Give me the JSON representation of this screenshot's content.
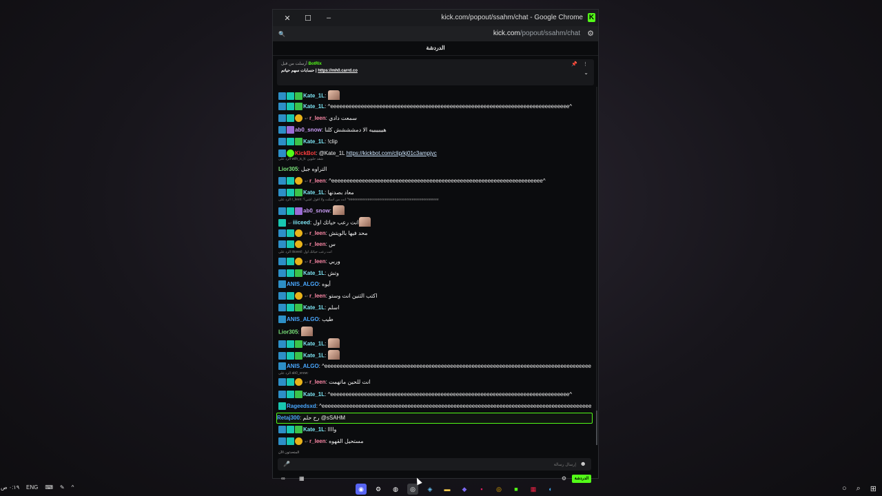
{
  "window": {
    "title": "kick.com/popout/ssahm/chat - Google Chrome",
    "close": "✕",
    "maximize": "☐",
    "minimize": "–",
    "logo": "K"
  },
  "urlbar": {
    "host": "kick.com",
    "path": "/popout/ssahm/chat",
    "search_icon": "🔍",
    "tune_icon": "⚙"
  },
  "chat": {
    "header": "الدردشة",
    "pinned": {
      "meta": "أرسلت من قبل",
      "bot_name": "BotRix",
      "text": "حسابات سهم حياتم |",
      "link": "https://mh0.carrd.co"
    },
    "typing_text": "المتحدثون الآن",
    "input_placeholder": "إرسال رسالة",
    "send_label": "الدردشة"
  },
  "messages": [
    {
      "user": "Kate_1L",
      "color": "#7ee5f5",
      "badges": [
        "blue",
        "teal",
        "green"
      ],
      "text": "",
      "emote": true
    },
    {
      "user": "Kate_1L",
      "color": "#7ee5f5",
      "badges": [
        "blue",
        "teal",
        "green"
      ],
      "text": "^eeeeeeeeeeeeeeeeeeeeeeeeeeeeeeeeeeeeeeeeeeeeeeeeeeeeeeeeeeeeeeeeeeeeeeeeeeeeee^"
    },
    {
      "user": "r_leen",
      "color": "#ff8aa8",
      "badges": [
        "blue",
        "teal",
        "gold"
      ],
      "text": "سمعت دادي",
      "arrow": true
    },
    {
      "user": "ab0_snow",
      "color": "#c79bf2",
      "badges": [
        "blue",
        "purple"
      ],
      "text": "هيييييييه الا دمشششش كلنا"
    },
    {
      "user": "Kate_1L",
      "color": "#7ee5f5",
      "badges": [
        "blue",
        "teal",
        "green"
      ],
      "text": "!clip"
    },
    {
      "user": "KickBot",
      "color": "#ff3e3e",
      "badges": [
        "blue",
        "star"
      ],
      "text": "@Kate_1L",
      "link": "https://kickbot.com/clip/kj01c3ampjyc"
    },
    {
      "user": "Lior305",
      "color": "#7ce67c",
      "badges": [],
      "text": "التراوه جبل"
    },
    {
      "user": "r_leen",
      "color": "#ff8aa8",
      "badges": [
        "blue",
        "teal",
        "gold"
      ],
      "text": "^eeeeeeeeeeeeeeeeeeeeeeeeeeeeeeeeeeeeeeeeeeeeeeeeeeeeeeeeeeeeeeeeeeeee^",
      "arrow": true
    },
    {
      "user": "Kate_1L",
      "color": "#7ee5f5",
      "badges": [
        "blue",
        "teal",
        "green"
      ],
      "text": "معاد بصدنها"
    },
    {
      "user": "ab0_snow",
      "color": "#c79bf2",
      "badges": [
        "blue",
        "teal",
        "purple"
      ],
      "text": "",
      "emote": true
    },
    {
      "user": "iiiceed",
      "color": "#7ee5f5",
      "badges": [
        "teal"
      ],
      "text": "انت رعب حياتك اول",
      "emote": true,
      "arrow": true
    },
    {
      "user": "r_leen",
      "color": "#ff8aa8",
      "badges": [
        "blue",
        "teal",
        "gold"
      ],
      "text": "محد فيها بالويتش",
      "arrow": true
    },
    {
      "user": "r_leen",
      "color": "#ff8aa8",
      "badges": [
        "blue",
        "teal",
        "gold"
      ],
      "text": "س",
      "arrow": true
    },
    {
      "user": "r_leen",
      "color": "#ff8aa8",
      "badges": [
        "blue",
        "teal",
        "gold"
      ],
      "text": "وربي",
      "arrow": true
    },
    {
      "user": "Kate_1L",
      "color": "#7ee5f5",
      "badges": [
        "blue",
        "teal",
        "green"
      ],
      "text": "وتش"
    },
    {
      "user": "ANIS_ALGO",
      "color": "#4aa8ff",
      "badges": [
        "blue"
      ],
      "text": "أيوه"
    },
    {
      "user": "r_leen",
      "color": "#ff8aa8",
      "badges": [
        "blue",
        "teal",
        "gold"
      ],
      "text": "اكتب الثنين انت وستو",
      "arrow": true
    },
    {
      "user": "Kate_1L",
      "color": "#7ee5f5",
      "badges": [
        "blue",
        "teal",
        "green"
      ],
      "text": "اسلم"
    },
    {
      "user": "ANIS_ALGO",
      "color": "#4aa8ff",
      "badges": [
        "blue"
      ],
      "text": "طيب"
    },
    {
      "user": "Lior305",
      "color": "#7ce67c",
      "badges": [],
      "text": "",
      "emote": true
    },
    {
      "user": "Kate_1L",
      "color": "#7ee5f5",
      "badges": [
        "blue",
        "teal",
        "green"
      ],
      "text": "",
      "emote": true
    },
    {
      "user": "Kate_1L",
      "color": "#7ee5f5",
      "badges": [
        "blue",
        "teal",
        "green"
      ],
      "text": "",
      "emote": true
    },
    {
      "user": "ANIS_ALGO",
      "color": "#4aa8ff",
      "badges": [
        "blue"
      ],
      "text": "^eeeeeeeeeeeeeeeeeeeeeeeeeeeeeeeeeeeeeeeeeeeeeeeeeeeeeeeeeeeeeeeeeeeeeeeeeeeeeeeeeeeeeeeee^"
    },
    {
      "user": "r_leen",
      "color": "#ff8aa8",
      "badges": [
        "blue",
        "teal",
        "gold"
      ],
      "text": "انت للحين ماتهمت",
      "arrow": true
    },
    {
      "user": "Kate_1L",
      "color": "#7ee5f5",
      "badges": [
        "blue",
        "teal",
        "green"
      ],
      "text": "^eeeeeeeeeeeeeeeeeeeeeeeeeeeeeeeeeeeeeeeeeeeeeeeeeeeeeeeeeeeeeeeeeeeeeeeeeeeeee^"
    },
    {
      "user": "Rageedsxd",
      "color": "#4aa8ff",
      "badges": [
        "teal"
      ],
      "text": "^eeeeeeeeeeeeeeeeeeeeeeeeeeeeeeeeeeeeeeeeeeeeeeeeeeeeeeeeeeeeeeeeeeeeeeeeeeeeeeeeeeeeeeeeeeeeeee^"
    },
    {
      "user": "Retaj300",
      "color": "#4aa8ff",
      "badges": [],
      "text": "رح حلم @sSAHM",
      "highlight": true
    },
    {
      "user": "Kate_1L",
      "color": "#7ee5f5",
      "badges": [
        "blue",
        "teal",
        "green"
      ],
      "text": "واااا"
    },
    {
      "user": "r_leen",
      "color": "#ff8aa8",
      "badges": [
        "blue",
        "teal",
        "gold"
      ],
      "text": "مستحيل القهوه",
      "arrow": true
    }
  ],
  "replies": [
    "الرد على wilh_a_k: شقد حلوين",
    "الرد على r_leen: انت من اسكت ولا اقول اشي؟ ^eeeeeeeeeeeeeeeeeeeeeeeeeeeeeeeeeeeeeeeeeeeeeee",
    "الرد على iiiceed: انت رعب حياتك اول",
    "الرد على ab0_snow:"
  ],
  "taskbar": {
    "time": "٠:١٩ ص",
    "lang": "ENG"
  }
}
